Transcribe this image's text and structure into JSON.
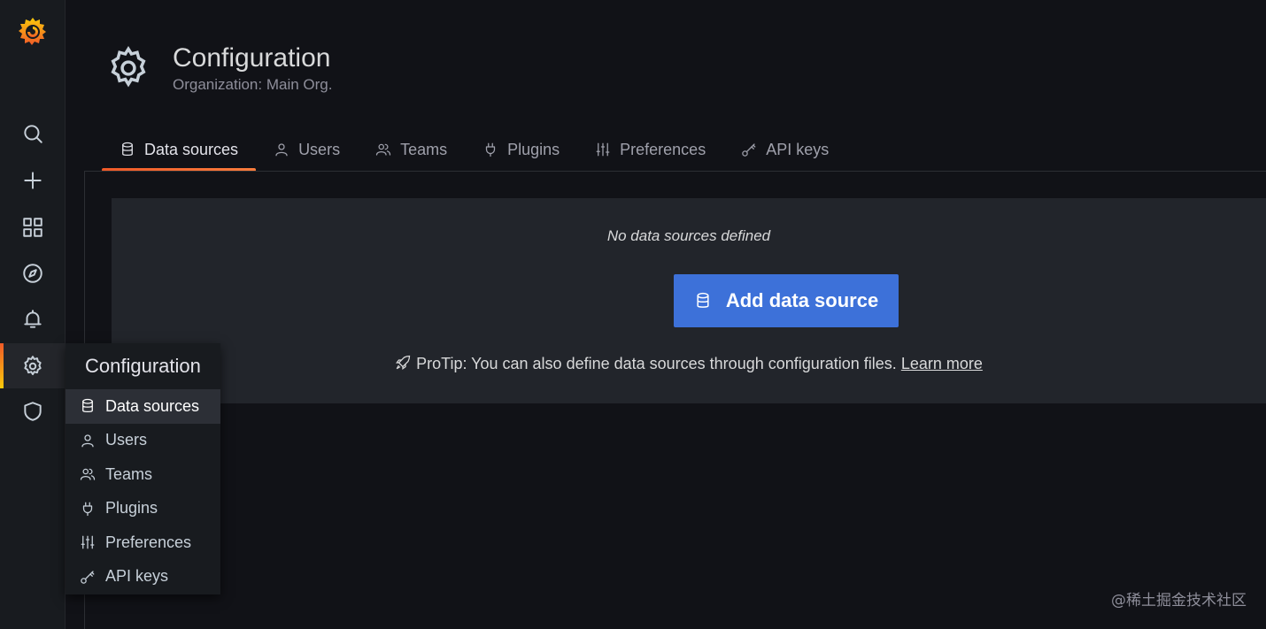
{
  "sidebar": {
    "logo": "grafana-logo",
    "items": [
      {
        "name": "search"
      },
      {
        "name": "create"
      },
      {
        "name": "dashboards"
      },
      {
        "name": "explore"
      },
      {
        "name": "alerting"
      },
      {
        "name": "configuration",
        "active": true
      },
      {
        "name": "server-admin"
      }
    ]
  },
  "header": {
    "title": "Configuration",
    "subtitle": "Organization: Main Org."
  },
  "tabs": [
    {
      "label": "Data sources",
      "icon": "database-icon",
      "active": true
    },
    {
      "label": "Users",
      "icon": "user-icon"
    },
    {
      "label": "Teams",
      "icon": "users-icon"
    },
    {
      "label": "Plugins",
      "icon": "plug-icon"
    },
    {
      "label": "Preferences",
      "icon": "sliders-icon"
    },
    {
      "label": "API keys",
      "icon": "key-icon"
    }
  ],
  "empty": {
    "title": "No data sources defined",
    "button_label": "Add data source",
    "protip_text": "ProTip: You can also define data sources through configuration files. ",
    "protip_link": "Learn more"
  },
  "dropdown": {
    "title": "Configuration",
    "items": [
      {
        "label": "Data sources",
        "active": true
      },
      {
        "label": "Users"
      },
      {
        "label": "Teams"
      },
      {
        "label": "Plugins"
      },
      {
        "label": "Preferences"
      },
      {
        "label": "API keys"
      }
    ]
  },
  "watermark": "@稀土掘金技术社区",
  "colors": {
    "accent_orange": "#f05a28",
    "primary_button": "#3d71d9",
    "background": "#111217",
    "sidebar": "#181b1f"
  }
}
